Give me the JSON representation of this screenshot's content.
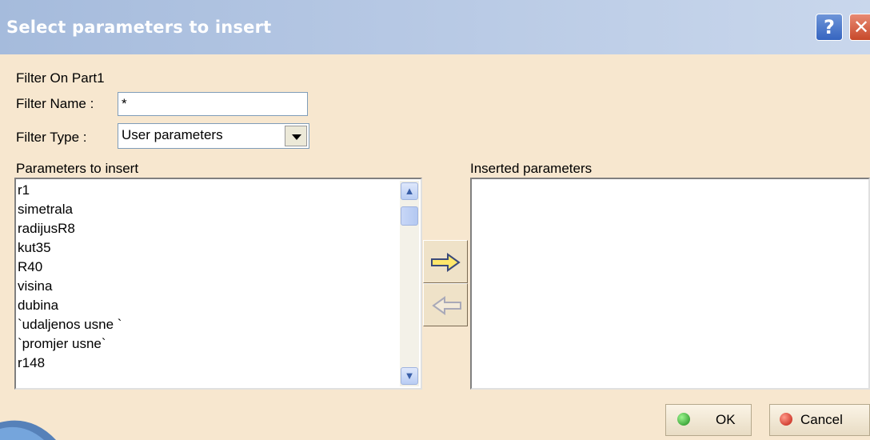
{
  "window": {
    "title": "Select parameters to insert",
    "help_label": "?",
    "close_label": "✕"
  },
  "filter": {
    "section_label": "Filter On Part1",
    "name_label": "Filter Name :",
    "name_value": "*",
    "type_label": "Filter Type :",
    "type_value": "User parameters"
  },
  "left_list": {
    "label": "Parameters to insert",
    "items": [
      "r1",
      "simetrala",
      "radijusR8",
      "kut35",
      "R40",
      "visina",
      "dubina",
      "`udaljenos usne `",
      "`promjer usne`",
      "r148"
    ]
  },
  "right_list": {
    "label": "Inserted parameters",
    "items": []
  },
  "buttons": {
    "ok_label": "OK",
    "cancel_label": "Cancel"
  },
  "icons": {
    "insert": "arrow-right-icon",
    "remove": "arrow-left-icon",
    "ok": "green-dot-icon",
    "cancel": "red-dot-icon"
  }
}
